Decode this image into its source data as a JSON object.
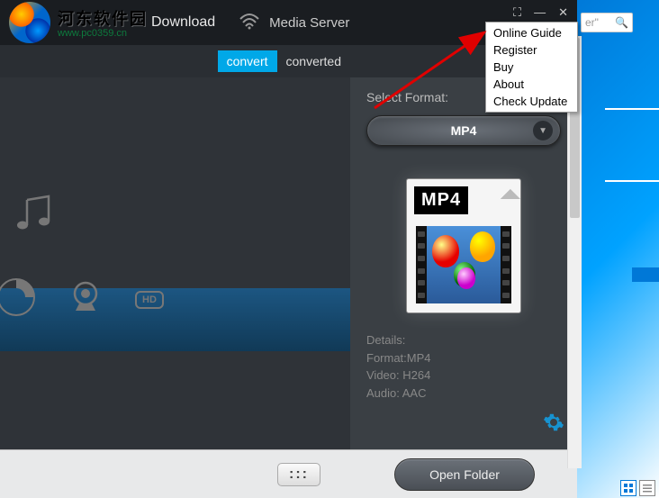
{
  "brand": {
    "cn": "河东软件园",
    "url": "www.pc0359.cn"
  },
  "topbar": {
    "download": "Download",
    "mediaserver": "Media Server"
  },
  "tabs": {
    "convert": "convert",
    "converted": "converted"
  },
  "right": {
    "select_label": "Select Format:",
    "format": "MP4",
    "thumb_label": "MP4",
    "details_title": "Details:",
    "format_line": "Format:MP4",
    "video_line": "Video: H264",
    "audio_line": "Audio: AAC"
  },
  "bottom": {
    "dots": ":::",
    "open_folder": "Open Folder"
  },
  "menu": {
    "items": [
      "Online Guide",
      "Register",
      "Buy",
      "About",
      "Check Update"
    ]
  },
  "search": {
    "placeholder": "er\"",
    "icon": "🔍"
  }
}
